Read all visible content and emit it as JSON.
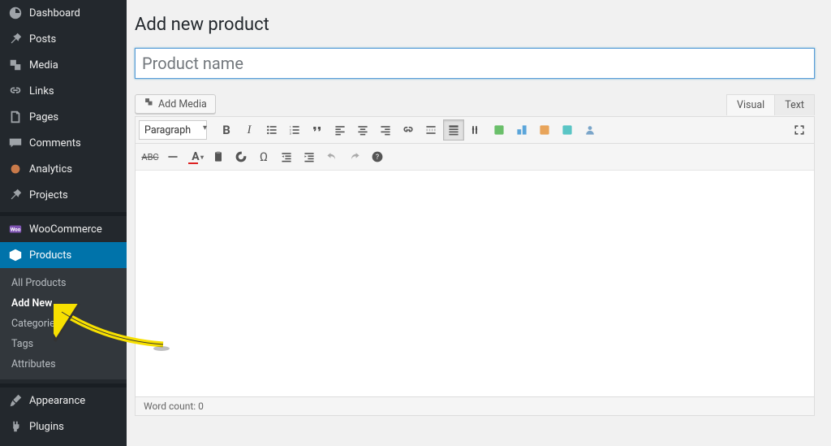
{
  "sidebar": {
    "items": [
      {
        "label": "Dashboard"
      },
      {
        "label": "Posts"
      },
      {
        "label": "Media"
      },
      {
        "label": "Links"
      },
      {
        "label": "Pages"
      },
      {
        "label": "Comments"
      },
      {
        "label": "Analytics"
      },
      {
        "label": "Projects"
      },
      {
        "label": "WooCommerce"
      },
      {
        "label": "Products"
      },
      {
        "label": "Appearance"
      },
      {
        "label": "Plugins"
      }
    ],
    "subitems": [
      {
        "label": "All Products"
      },
      {
        "label": "Add New"
      },
      {
        "label": "Categories"
      },
      {
        "label": "Tags"
      },
      {
        "label": "Attributes"
      }
    ]
  },
  "page": {
    "title": "Add new product",
    "title_placeholder": "Product name"
  },
  "media": {
    "add_media_label": "Add Media"
  },
  "editor": {
    "tabs": {
      "visual": "Visual",
      "text": "Text"
    },
    "format_label": "Paragraph",
    "word_count_label": "Word count: 0"
  }
}
